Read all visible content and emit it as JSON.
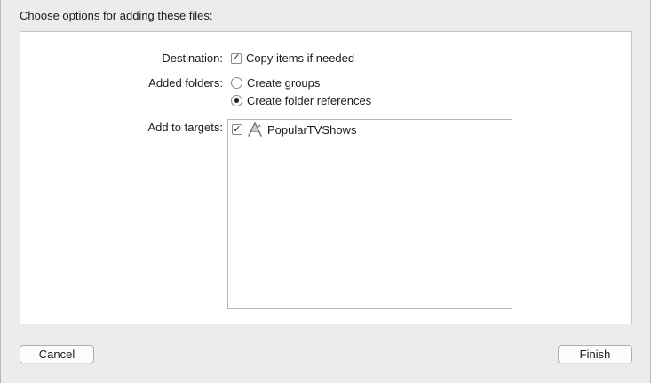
{
  "dialog": {
    "prompt": "Choose options for adding these files:"
  },
  "options": {
    "destination_label": "Destination:",
    "copy_items_label": "Copy items if needed",
    "copy_items_checked": true,
    "added_folders_label": "Added folders:",
    "create_groups_label": "Create groups",
    "create_folder_refs_label": "Create folder references",
    "selected_folder_option": "Create folder references",
    "add_to_targets_label": "Add to targets:"
  },
  "targets": [
    {
      "name": "PopularTVShows",
      "checked": true,
      "icon": "app-target-icon"
    }
  ],
  "buttons": {
    "cancel": "Cancel",
    "finish": "Finish"
  }
}
